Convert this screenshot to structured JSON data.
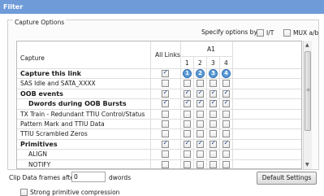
{
  "window": {
    "title": "Filter"
  },
  "capture_options": {
    "label": "Capture Options"
  },
  "specify": {
    "label": "Specify options by:",
    "options": [
      {
        "label": "I/T",
        "checked": false
      },
      {
        "label": "MUX a/b",
        "checked": false
      }
    ]
  },
  "grid": {
    "col_capture": "Capture",
    "col_all_links": "All Links",
    "link_group": "A1",
    "link_numbers": [
      "1",
      "2",
      "3",
      "4"
    ],
    "rows": [
      {
        "label": "Capture this link",
        "bold": true,
        "all": true,
        "links": [
          true,
          true,
          true,
          true
        ],
        "badges": [
          "1",
          "2",
          "3",
          "4"
        ]
      },
      {
        "label": "SAS Idle and SATA_XXXX",
        "bold": false,
        "all": false,
        "links": [
          false,
          false,
          false,
          false
        ]
      },
      {
        "label": "OOB events",
        "bold": true,
        "all": true,
        "links": [
          true,
          true,
          true,
          true
        ]
      },
      {
        "label": "Dwords during OOB Bursts",
        "bold": true,
        "indent": true,
        "all": true,
        "links": [
          true,
          true,
          true,
          true
        ]
      },
      {
        "label": "TX Train - Redundant TTIU Control/Status",
        "bold": false,
        "all": false,
        "links": [
          false,
          false,
          false,
          false
        ]
      },
      {
        "label": "Pattern Mark and TTIU Data",
        "bold": false,
        "all": false,
        "links": [
          false,
          false,
          false,
          false
        ]
      },
      {
        "label": "TTIU Scrambled Zeros",
        "bold": false,
        "all": false,
        "links": [
          false,
          false,
          false,
          false
        ]
      },
      {
        "label": "Primitives",
        "bold": true,
        "all": true,
        "links": [
          true,
          true,
          true,
          true
        ]
      },
      {
        "label": "ALIGN",
        "bold": false,
        "indent": true,
        "all": false,
        "links": [
          false,
          false,
          false,
          false
        ]
      },
      {
        "label": "NOTIFY",
        "bold": false,
        "indent": true,
        "all": false,
        "links": [
          false,
          false,
          false,
          false
        ]
      }
    ]
  },
  "clip": {
    "label": "Clip Data frames after",
    "value": "0",
    "unit": "dwords"
  },
  "default_button": {
    "label": "Default Settings"
  },
  "strong_compression": {
    "label": "Strong primitive compression",
    "checked": false
  },
  "colors": {
    "titlebar": "#6f9bd9",
    "badge": "#5b9bd5",
    "check": "#23448a"
  },
  "icons": [
    "checkbox",
    "scroll-up-arrow",
    "scroll-down-arrow",
    "scroll-grip"
  ]
}
